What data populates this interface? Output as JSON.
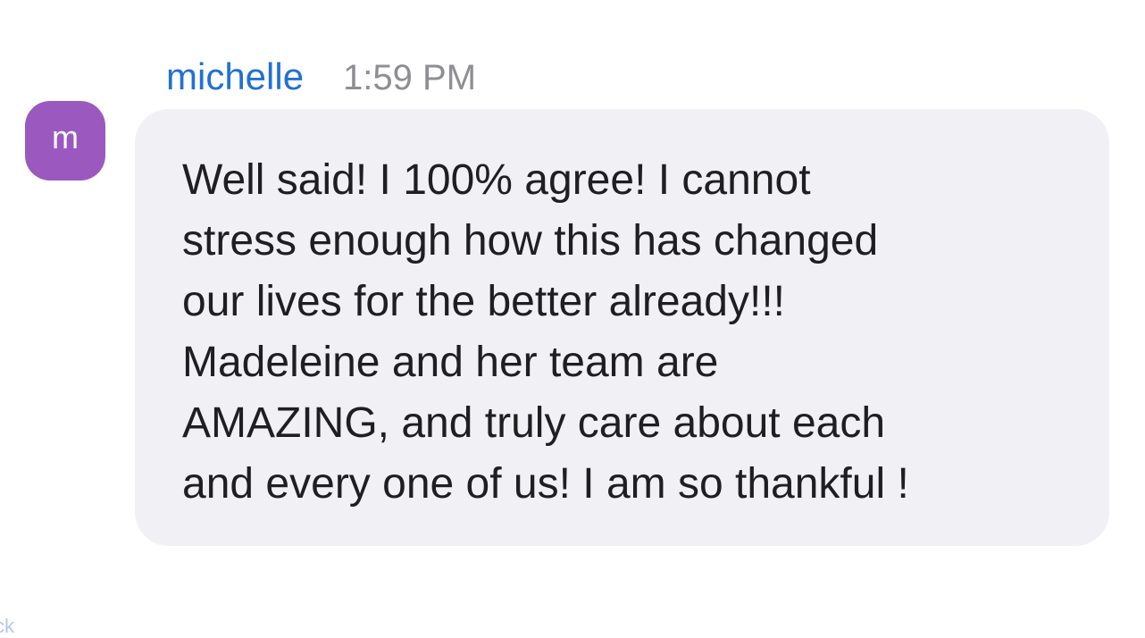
{
  "message": {
    "avatar_letter": "m",
    "sender": "michelle",
    "time": "1:59 PM",
    "text": "Well said! I 100% agree!  I cannot\nstress enough how this has changed\nour lives for the better already!!!\nMadeleine and her team are\nAMAZING, and truly care about each\nand every one of us! I am so thankful  !"
  },
  "footer": {
    "fragment": "ck"
  },
  "colors": {
    "avatar_bg": "#9b59c0",
    "sender": "#2270d6",
    "time": "#8e8e93",
    "bubble_bg": "#f1f1f5",
    "text": "#1f1f21"
  }
}
